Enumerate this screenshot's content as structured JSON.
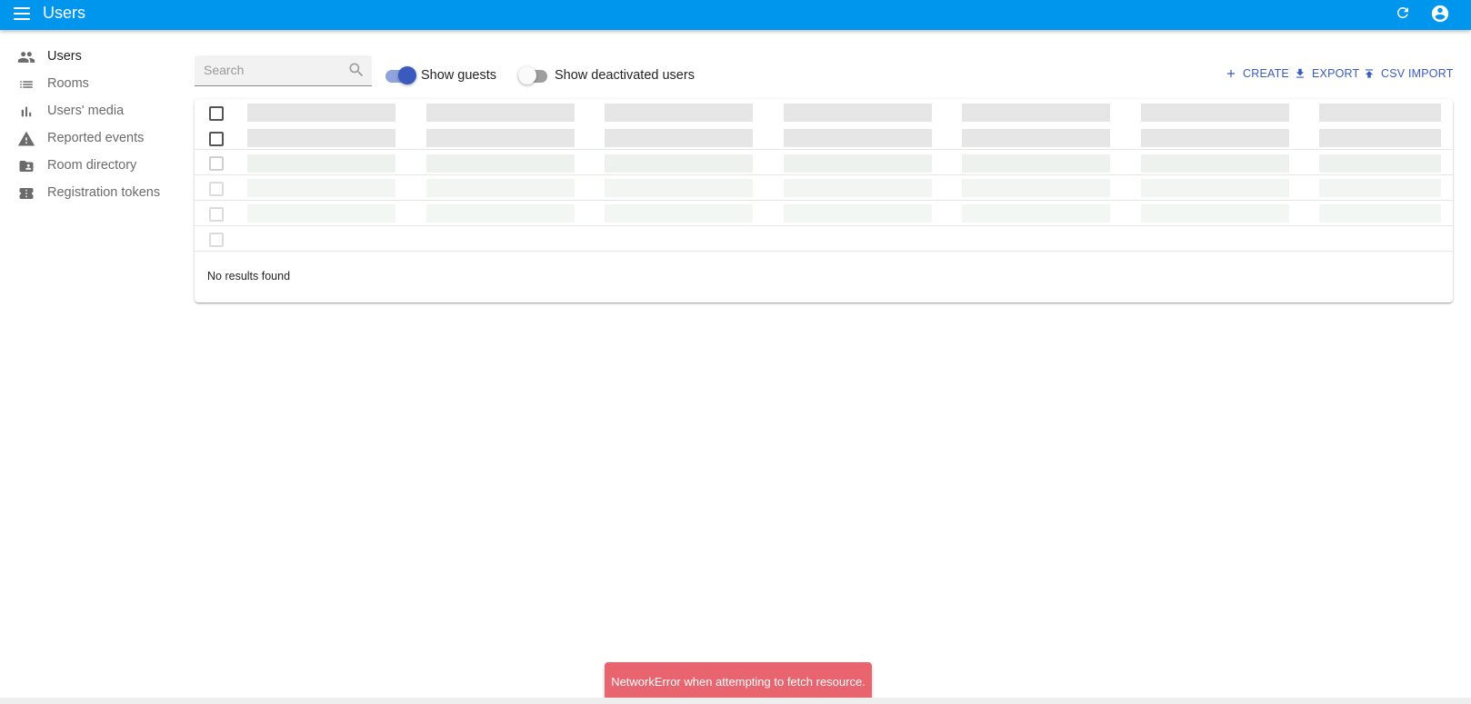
{
  "appbar": {
    "title": "Users",
    "color": "#0096ee",
    "icons": [
      "menu-icon",
      "refresh-icon",
      "account-circle-icon"
    ]
  },
  "sidebar": {
    "items": [
      {
        "label": "Users",
        "icon": "people-icon",
        "active": true
      },
      {
        "label": "Rooms",
        "icon": "list-icon",
        "active": false
      },
      {
        "label": "Users' media",
        "icon": "bar-chart-icon",
        "active": false
      },
      {
        "label": "Reported events",
        "icon": "warning-icon",
        "active": false
      },
      {
        "label": "Room directory",
        "icon": "folder-shared-icon",
        "active": false
      },
      {
        "label": "Registration tokens",
        "icon": "ticket-icon",
        "active": false
      }
    ]
  },
  "toolbar": {
    "search_placeholder": "Search",
    "search_value": "",
    "show_guests_label": "Show guests",
    "show_guests_on": true,
    "show_deactivated_label": "Show deactivated users",
    "show_deactivated_on": false,
    "create_label": "CREATE",
    "export_label": "EXPORT",
    "csv_import_label": "CSV IMPORT",
    "accent_color": "#3a5bbd"
  },
  "table": {
    "loading_rows": 5,
    "skeleton_columns": 7,
    "empty_message": "No results found"
  },
  "snackbar": {
    "message": "NetworkError when attempting to fetch resource.",
    "color": "#e8646e"
  }
}
